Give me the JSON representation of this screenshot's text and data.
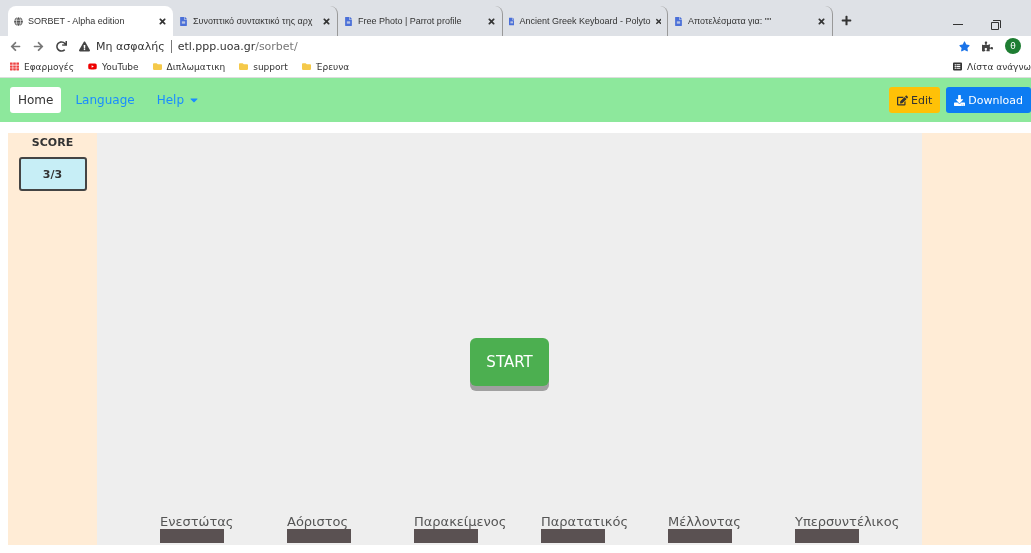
{
  "browser": {
    "tabs": [
      {
        "title": "SORBET - Alpha edition",
        "selected": true
      },
      {
        "title": "Συνοπτικό συντακτικό της αρχ",
        "selected": false
      },
      {
        "title": "Free Photo | Parrot profile",
        "selected": false
      },
      {
        "title": "Ancient Greek Keyboard - Polyto",
        "selected": false
      },
      {
        "title": "Αποτελέσματα για: \"\"",
        "selected": false
      }
    ],
    "profile_initial": "θ",
    "address": {
      "security": "Μη ασφαλής",
      "host": "etl.ppp.uoa.gr",
      "path": "/sorbet/"
    },
    "bookmarks": [
      {
        "label": "Εφαρμογές",
        "kind": "apps"
      },
      {
        "label": "YouTube",
        "kind": "youtube"
      },
      {
        "label": "Διπλωματικη",
        "kind": "folder"
      },
      {
        "label": "support",
        "kind": "folder"
      },
      {
        "label": "Έρευνα",
        "kind": "folder"
      }
    ],
    "reading_list": "Λίστα ανάγνω"
  },
  "navbar": {
    "items": [
      {
        "label": "Home",
        "selected": true,
        "kind": "link"
      },
      {
        "label": "Language",
        "selected": false,
        "kind": "link"
      },
      {
        "label": "Help",
        "selected": false,
        "kind": "dropdown"
      }
    ],
    "buttons": [
      {
        "label": "Edit",
        "kind": "edit"
      },
      {
        "label": "Download",
        "kind": "download"
      }
    ]
  },
  "score": {
    "title": "SCORE",
    "value": "3/3"
  },
  "start_button": "START",
  "tenses": [
    "Ενεστώτας",
    "Αόριστος",
    "Παρακείμενος",
    "Παρατατικός",
    "Μέλλοντας",
    "Υπερσυντέλικος"
  ]
}
